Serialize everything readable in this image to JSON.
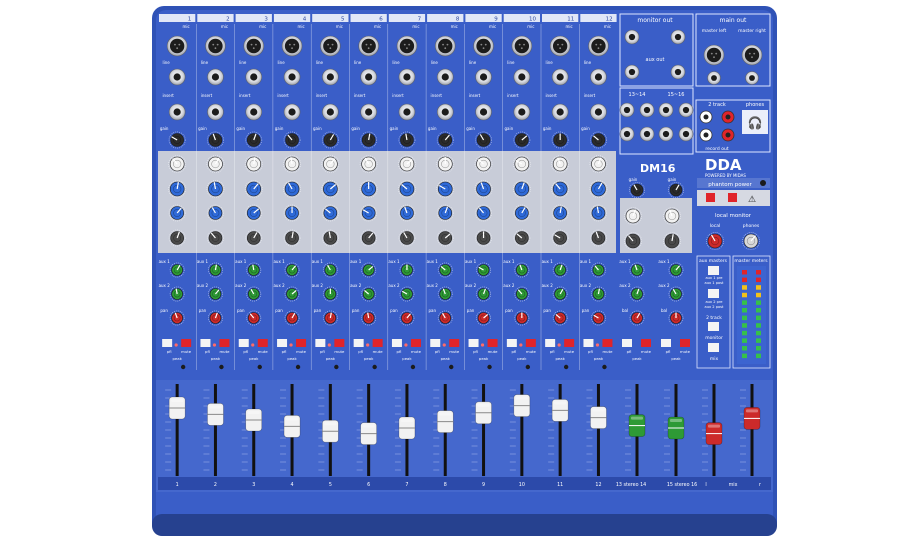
{
  "channels": [
    "1",
    "2",
    "3",
    "4",
    "5",
    "6",
    "7",
    "8",
    "9",
    "10",
    "11",
    "12"
  ],
  "strip_labels": {
    "mic": "mic",
    "line": "line",
    "insert": "insert",
    "gain": "gain",
    "high": "high",
    "hi_mid": "hi mid",
    "lo_mid": "lo mid",
    "low": "low",
    "aux1": "aux 1",
    "aux2": "aux 2",
    "pan": "pan",
    "bal": "bal",
    "pfl": "pfl",
    "mute": "mute",
    "peak": "peak"
  },
  "sections": {
    "monitor_out": "monitor out",
    "aux_out": "aux out",
    "aux_out_sub": "aux",
    "main_out": "main out",
    "master_left": "master left",
    "master_right": "master right",
    "ch13_14": "13~14",
    "ch15_16": "15~16",
    "two_track": "2 track",
    "phones": "phones",
    "record_out": "record out",
    "phantom_power": "phantom power",
    "local_monitor": "local monitor",
    "local": "local",
    "aux_masters": "aux masters",
    "master_meters": "master meters",
    "aux1_pre": "aux 1 pre",
    "aux1_post": "aux 1 post",
    "aux2_pre": "aux 2 pre",
    "aux2_post": "aux 2 post",
    "two_track_btn": "2 track",
    "monitor": "monitor",
    "mix": "mix"
  },
  "brand": {
    "model": "DM16",
    "logo": "DDA",
    "tagline": "POWERED BY MIDAS"
  },
  "fader_labels": [
    "1",
    "2",
    "3",
    "4",
    "5",
    "6",
    "7",
    "8",
    "9",
    "10",
    "11",
    "12",
    "13 stereo 14",
    "15 stereo 16",
    "l",
    "mix",
    "r"
  ],
  "fader_levels": [
    0.85,
    0.77,
    0.7,
    0.62,
    0.56,
    0.53,
    0.6,
    0.68,
    0.79,
    0.88,
    0.82,
    0.73,
    0.63,
    0.6,
    0.53,
    0.72
  ],
  "colors": {
    "panel": "#3a5ec8",
    "panel_dark": "#2a45a0",
    "eq_bg": "#c8ccd8",
    "knob_green": "#2e9a35",
    "knob_red": "#cc2a2a",
    "knob_blue": "#2f6ad8",
    "button_red": "#e0242a",
    "button_white": "#f4f4f4"
  }
}
